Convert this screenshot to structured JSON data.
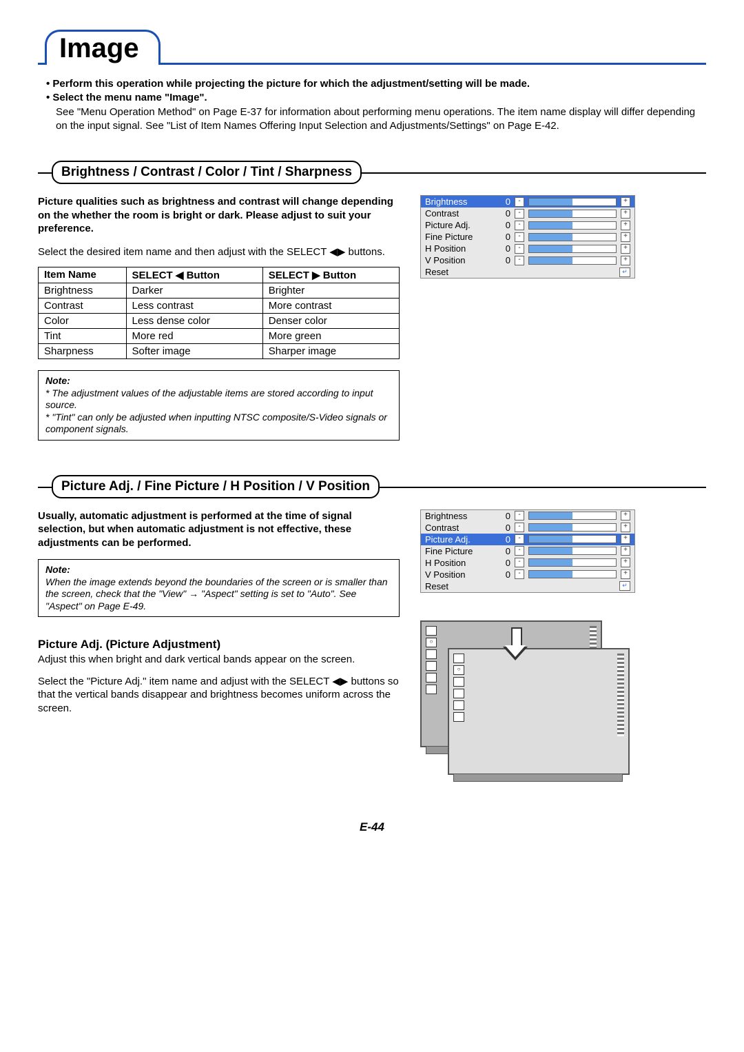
{
  "page_title": "Image",
  "intro": {
    "bullet1": "• Perform this operation while projecting the picture for which the adjustment/setting will be made.",
    "bullet2": "• Select the menu name \"Image\".",
    "body": "See \"Menu Operation Method\" on Page E-37 for information about performing menu operations. The item name display will differ depending on the input signal. See \"List of Item Names Offering Input Selection and Adjustments/Settings\" on Page E-42."
  },
  "sec1": {
    "heading": "Brightness / Contrast / Color / Tint / Sharpness",
    "p_bold": "Picture qualities such as brightness and contrast will change depending on the whether the room is bright or dark. Please adjust to suit your preference.",
    "p_body": "Select the desired item name and then adjust with the SELECT ◀▶ buttons.",
    "table": {
      "headers": [
        "Item Name",
        "SELECT ◀ Button",
        "SELECT ▶ Button"
      ],
      "rows": [
        [
          "Brightness",
          "Darker",
          "Brighter"
        ],
        [
          "Contrast",
          "Less contrast",
          "More contrast"
        ],
        [
          "Color",
          "Less dense color",
          "Denser color"
        ],
        [
          "Tint",
          "More red",
          "More green"
        ],
        [
          "Sharpness",
          "Softer image",
          "Sharper image"
        ]
      ]
    },
    "note_label": "Note:",
    "note_items": [
      "The adjustment values of the adjustable items are stored according to input source.",
      "\"Tint\" can only be adjusted when inputting NTSC composite/S-Video signals or component signals."
    ]
  },
  "osd": {
    "rows": [
      {
        "label": "Brightness",
        "val": "0"
      },
      {
        "label": "Contrast",
        "val": "0"
      },
      {
        "label": "Picture Adj.",
        "val": "0"
      },
      {
        "label": "Fine Picture",
        "val": "0"
      },
      {
        "label": "H Position",
        "val": "0"
      },
      {
        "label": "V Position",
        "val": "0"
      }
    ],
    "reset": "Reset",
    "highlight1": 0,
    "highlight2": 2
  },
  "sec2": {
    "heading": "Picture Adj. / Fine Picture / H Position / V Position",
    "p_bold": "Usually, automatic adjustment is performed at the time of signal selection, but when automatic adjustment is not effective, these adjustments can be performed.",
    "note_label": "Note:",
    "note_body": "When the image extends beyond the boundaries of the screen or is smaller than the screen, check that the \"View\" → \"Aspect\" setting is set to \"Auto\". See \"Aspect\" on Page E-49."
  },
  "sec3": {
    "heading": "Picture Adj. (Picture Adjustment)",
    "p1": "Adjust this when bright and dark vertical bands appear on the screen.",
    "p2": "Select the \"Picture Adj.\" item name and adjust with the SELECT ◀▶ buttons so that the vertical bands disappear and brightness becomes uniform across the screen."
  },
  "page_num": "E-44"
}
